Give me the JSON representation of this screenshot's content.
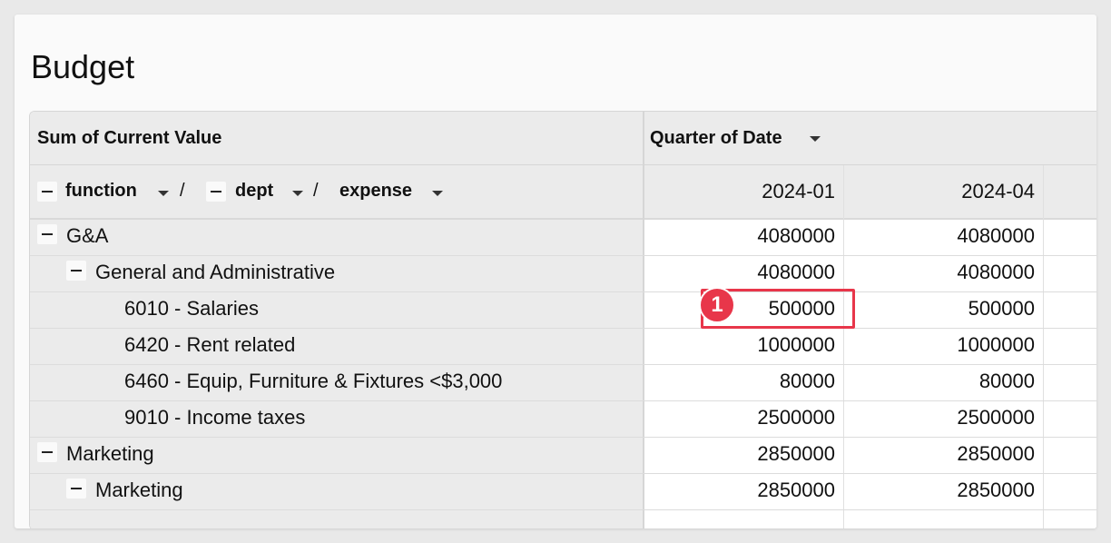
{
  "title": "Budget",
  "pivot": {
    "value_label": "Sum of Current Value",
    "column_field": "Quarter of Date",
    "row_fields": [
      "function",
      "dept",
      "expense"
    ],
    "columns": [
      "2024-01",
      "2024-04"
    ],
    "rows": [
      {
        "label": "G&A",
        "level": 0,
        "collapsible": true,
        "values": [
          "4080000",
          "4080000"
        ]
      },
      {
        "label": "General and Administrative",
        "level": 1,
        "collapsible": true,
        "values": [
          "4080000",
          "4080000"
        ]
      },
      {
        "label": "6010 - Salaries",
        "level": 2,
        "collapsible": false,
        "values": [
          "500000",
          "500000"
        ]
      },
      {
        "label": "6420 - Rent related",
        "level": 2,
        "collapsible": false,
        "values": [
          "1000000",
          "1000000"
        ]
      },
      {
        "label": "6460 - Equip, Furniture & Fixtures <$3,000",
        "level": 2,
        "collapsible": false,
        "values": [
          "80000",
          "80000"
        ]
      },
      {
        "label": "9010 - Income taxes",
        "level": 2,
        "collapsible": false,
        "values": [
          "2500000",
          "2500000"
        ]
      },
      {
        "label": "Marketing",
        "level": 0,
        "collapsible": true,
        "values": [
          "2850000",
          "2850000"
        ]
      },
      {
        "label": "Marketing",
        "level": 1,
        "collapsible": true,
        "values": [
          "2850000",
          "2850000"
        ]
      }
    ]
  },
  "annotation": {
    "badge": "1",
    "color": "#e8364a"
  }
}
